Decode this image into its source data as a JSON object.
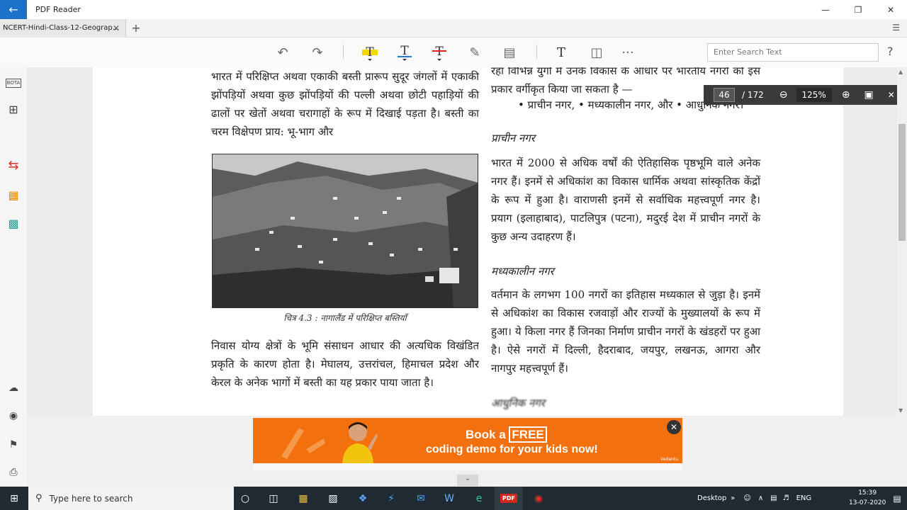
{
  "app": {
    "back_icon": "arrow-left-icon",
    "title": "PDF Reader"
  },
  "window_controls": {
    "minimize": "—",
    "maximize": "❐",
    "close": "✕"
  },
  "tabs": [
    {
      "label": "NCERT-Hindi-Class-12-Geograp...",
      "close": "✕"
    }
  ],
  "tab_add": "+",
  "toolbar": {
    "search_placeholder": "Enter Search Text",
    "text_tool": "T",
    "more": "···",
    "help": "?"
  },
  "left_rail": {
    "bota": "BOTA"
  },
  "document": {
    "col1_para1": "भारत में परिक्षिप्त अथवा एकाकी बस्ती प्रारूप सुदूर जंगलों में एकाकी झोंपड़ियों अथवा कुछ झोंपड़ियों की पल्ली अथवा छोटी पहाड़ियों की ढालों पर खेतों अथवा चरागाहों के रूप में दिखाई पड़ता है। बस्ती का चरम विक्षेपण प्राय: भू-भाग और",
    "caption": "चित्र 4.3 : नागालैंड में परिक्षिप्त बस्तियाँ",
    "col1_para2": "निवास योग्य क्षेत्रों के भूमि संसाधन आधार की अत्यधिक विखंडित प्रकृति के कारण होता है। मेघालय, उत्तरांचल, हिमाचल प्रदेश और केरल के अनेक भागों में बस्ती का यह प्रकार पाया जाता है।",
    "col2_top": "रहा विभिन्न युगों में उनके विकास के आधार पर भारतीय नगरों को इस प्रकार वर्गीकृत किया जा सकता है —",
    "col2_bullets": "• प्राचीन नगर, • मध्यकालीन नगर, और • आधुनिक नगर।",
    "heading_ancient": "प्राचीन नगर",
    "para_ancient": "भारत में 2000 से अधिक वर्षों की ऐतिहासिक पृष्ठभूमि वाले अनेक नगर हैं। इनमें से अधिकांश का विकास धार्मिक अथवा सांस्कृतिक केंद्रों के रूप में हुआ है। वाराणसी इनमें से सर्वाधिक महत्त्वपूर्ण नगर है। प्रयाग (इलाहाबाद), पाटलिपुत्र (पटना), मदुरई देश में प्राचीन नगरों के कुछ अन्य उदाहरण हैं।",
    "heading_medieval": "मध्यकालीन नगर",
    "para_medieval": "वर्तमान के लगभग 100 नगरों का इतिहास मध्यकाल से जुड़ा है। इनमें से अधिकांश का विकास रजवाड़ों और राज्यों के मुख्यालयों के रूप में हुआ। ये किला नगर हैं जिनका निर्माण प्राचीन नगरों के खंडहरों पर हुआ है। ऐसे नगरों में दिल्ली, हैदराबाद, जयपुर, लखनऊ, आगरा और नागपुर महत्त्वपूर्ण हैं।",
    "heading_modern": "आधुनिक नगर"
  },
  "page_nav": {
    "current": "46",
    "total": "/ 172",
    "zoom": "125%"
  },
  "ad": {
    "line1_pre": "Book a ",
    "line1_free": "FREE",
    "line2": "coding demo for your kids now!",
    "brand": "Vedantu"
  },
  "taskbar": {
    "search_placeholder": "Type here to search",
    "desktop": "Desktop",
    "lang": "ENG",
    "time": "15:39",
    "date": "13-07-2020"
  }
}
